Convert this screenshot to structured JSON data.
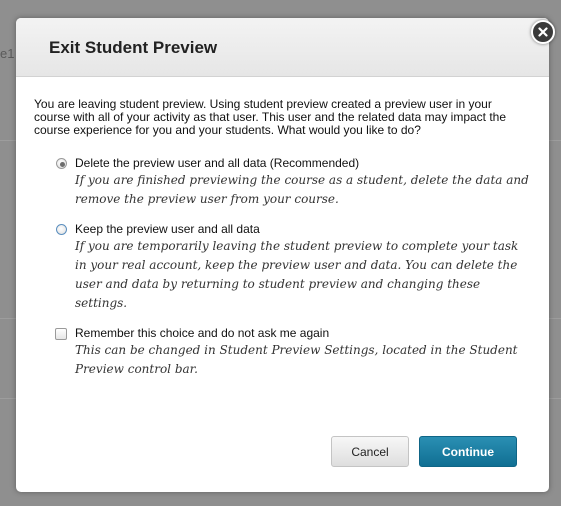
{
  "background": {
    "fragment_text": "e1"
  },
  "dialog": {
    "title": "Exit Student Preview",
    "intro": "You are leaving student preview. Using student preview created a preview user in your course with all of your activity as that user. This user and the related data may impact the course experience for you and your students. What would you like to do?",
    "options": [
      {
        "label": "Delete the preview user and all data (Recommended)",
        "description": "If you are finished previewing the course as a student, delete the data and remove the preview user from your course.",
        "selected": true
      },
      {
        "label": "Keep the preview user and all data",
        "description": "If you are temporarily leaving the student preview to complete your task in your real account, keep the preview user and data. You can delete the user and data by returning to student preview and changing these settings.",
        "selected": false
      }
    ],
    "remember": {
      "label": "Remember this choice and do not ask me again",
      "description": "This can be changed in Student Preview Settings, located in the Student Preview control bar.",
      "checked": false
    },
    "buttons": {
      "cancel": "Cancel",
      "continue": "Continue"
    }
  },
  "icons": {
    "close": "close-icon"
  },
  "colors": {
    "primary_button": "#1a7fa5",
    "header_bg": "#ececec",
    "overlay": "#8e8e8e"
  }
}
